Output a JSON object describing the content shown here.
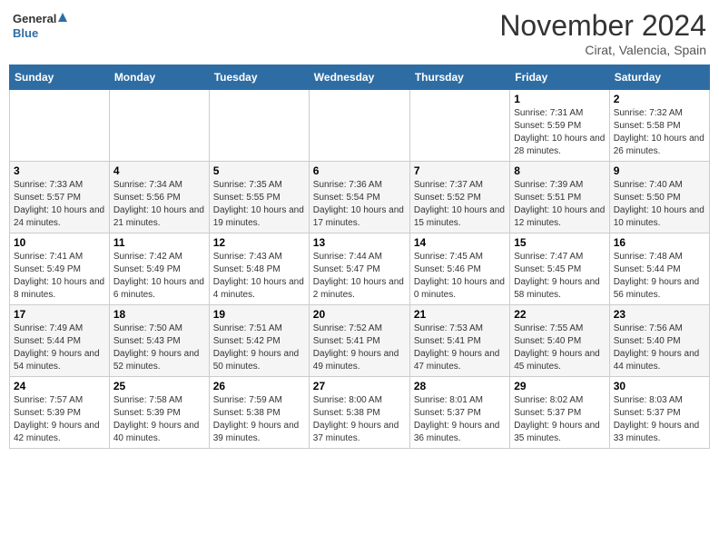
{
  "header": {
    "logo_line1": "General",
    "logo_line2": "Blue",
    "month_title": "November 2024",
    "subtitle": "Cirat, Valencia, Spain"
  },
  "weekdays": [
    "Sunday",
    "Monday",
    "Tuesday",
    "Wednesday",
    "Thursday",
    "Friday",
    "Saturday"
  ],
  "weeks": [
    [
      {
        "day": "",
        "info": ""
      },
      {
        "day": "",
        "info": ""
      },
      {
        "day": "",
        "info": ""
      },
      {
        "day": "",
        "info": ""
      },
      {
        "day": "",
        "info": ""
      },
      {
        "day": "1",
        "info": "Sunrise: 7:31 AM\nSunset: 5:59 PM\nDaylight: 10 hours and 28 minutes."
      },
      {
        "day": "2",
        "info": "Sunrise: 7:32 AM\nSunset: 5:58 PM\nDaylight: 10 hours and 26 minutes."
      }
    ],
    [
      {
        "day": "3",
        "info": "Sunrise: 7:33 AM\nSunset: 5:57 PM\nDaylight: 10 hours and 24 minutes."
      },
      {
        "day": "4",
        "info": "Sunrise: 7:34 AM\nSunset: 5:56 PM\nDaylight: 10 hours and 21 minutes."
      },
      {
        "day": "5",
        "info": "Sunrise: 7:35 AM\nSunset: 5:55 PM\nDaylight: 10 hours and 19 minutes."
      },
      {
        "day": "6",
        "info": "Sunrise: 7:36 AM\nSunset: 5:54 PM\nDaylight: 10 hours and 17 minutes."
      },
      {
        "day": "7",
        "info": "Sunrise: 7:37 AM\nSunset: 5:52 PM\nDaylight: 10 hours and 15 minutes."
      },
      {
        "day": "8",
        "info": "Sunrise: 7:39 AM\nSunset: 5:51 PM\nDaylight: 10 hours and 12 minutes."
      },
      {
        "day": "9",
        "info": "Sunrise: 7:40 AM\nSunset: 5:50 PM\nDaylight: 10 hours and 10 minutes."
      }
    ],
    [
      {
        "day": "10",
        "info": "Sunrise: 7:41 AM\nSunset: 5:49 PM\nDaylight: 10 hours and 8 minutes."
      },
      {
        "day": "11",
        "info": "Sunrise: 7:42 AM\nSunset: 5:49 PM\nDaylight: 10 hours and 6 minutes."
      },
      {
        "day": "12",
        "info": "Sunrise: 7:43 AM\nSunset: 5:48 PM\nDaylight: 10 hours and 4 minutes."
      },
      {
        "day": "13",
        "info": "Sunrise: 7:44 AM\nSunset: 5:47 PM\nDaylight: 10 hours and 2 minutes."
      },
      {
        "day": "14",
        "info": "Sunrise: 7:45 AM\nSunset: 5:46 PM\nDaylight: 10 hours and 0 minutes."
      },
      {
        "day": "15",
        "info": "Sunrise: 7:47 AM\nSunset: 5:45 PM\nDaylight: 9 hours and 58 minutes."
      },
      {
        "day": "16",
        "info": "Sunrise: 7:48 AM\nSunset: 5:44 PM\nDaylight: 9 hours and 56 minutes."
      }
    ],
    [
      {
        "day": "17",
        "info": "Sunrise: 7:49 AM\nSunset: 5:44 PM\nDaylight: 9 hours and 54 minutes."
      },
      {
        "day": "18",
        "info": "Sunrise: 7:50 AM\nSunset: 5:43 PM\nDaylight: 9 hours and 52 minutes."
      },
      {
        "day": "19",
        "info": "Sunrise: 7:51 AM\nSunset: 5:42 PM\nDaylight: 9 hours and 50 minutes."
      },
      {
        "day": "20",
        "info": "Sunrise: 7:52 AM\nSunset: 5:41 PM\nDaylight: 9 hours and 49 minutes."
      },
      {
        "day": "21",
        "info": "Sunrise: 7:53 AM\nSunset: 5:41 PM\nDaylight: 9 hours and 47 minutes."
      },
      {
        "day": "22",
        "info": "Sunrise: 7:55 AM\nSunset: 5:40 PM\nDaylight: 9 hours and 45 minutes."
      },
      {
        "day": "23",
        "info": "Sunrise: 7:56 AM\nSunset: 5:40 PM\nDaylight: 9 hours and 44 minutes."
      }
    ],
    [
      {
        "day": "24",
        "info": "Sunrise: 7:57 AM\nSunset: 5:39 PM\nDaylight: 9 hours and 42 minutes."
      },
      {
        "day": "25",
        "info": "Sunrise: 7:58 AM\nSunset: 5:39 PM\nDaylight: 9 hours and 40 minutes."
      },
      {
        "day": "26",
        "info": "Sunrise: 7:59 AM\nSunset: 5:38 PM\nDaylight: 9 hours and 39 minutes."
      },
      {
        "day": "27",
        "info": "Sunrise: 8:00 AM\nSunset: 5:38 PM\nDaylight: 9 hours and 37 minutes."
      },
      {
        "day": "28",
        "info": "Sunrise: 8:01 AM\nSunset: 5:37 PM\nDaylight: 9 hours and 36 minutes."
      },
      {
        "day": "29",
        "info": "Sunrise: 8:02 AM\nSunset: 5:37 PM\nDaylight: 9 hours and 35 minutes."
      },
      {
        "day": "30",
        "info": "Sunrise: 8:03 AM\nSunset: 5:37 PM\nDaylight: 9 hours and 33 minutes."
      }
    ]
  ]
}
